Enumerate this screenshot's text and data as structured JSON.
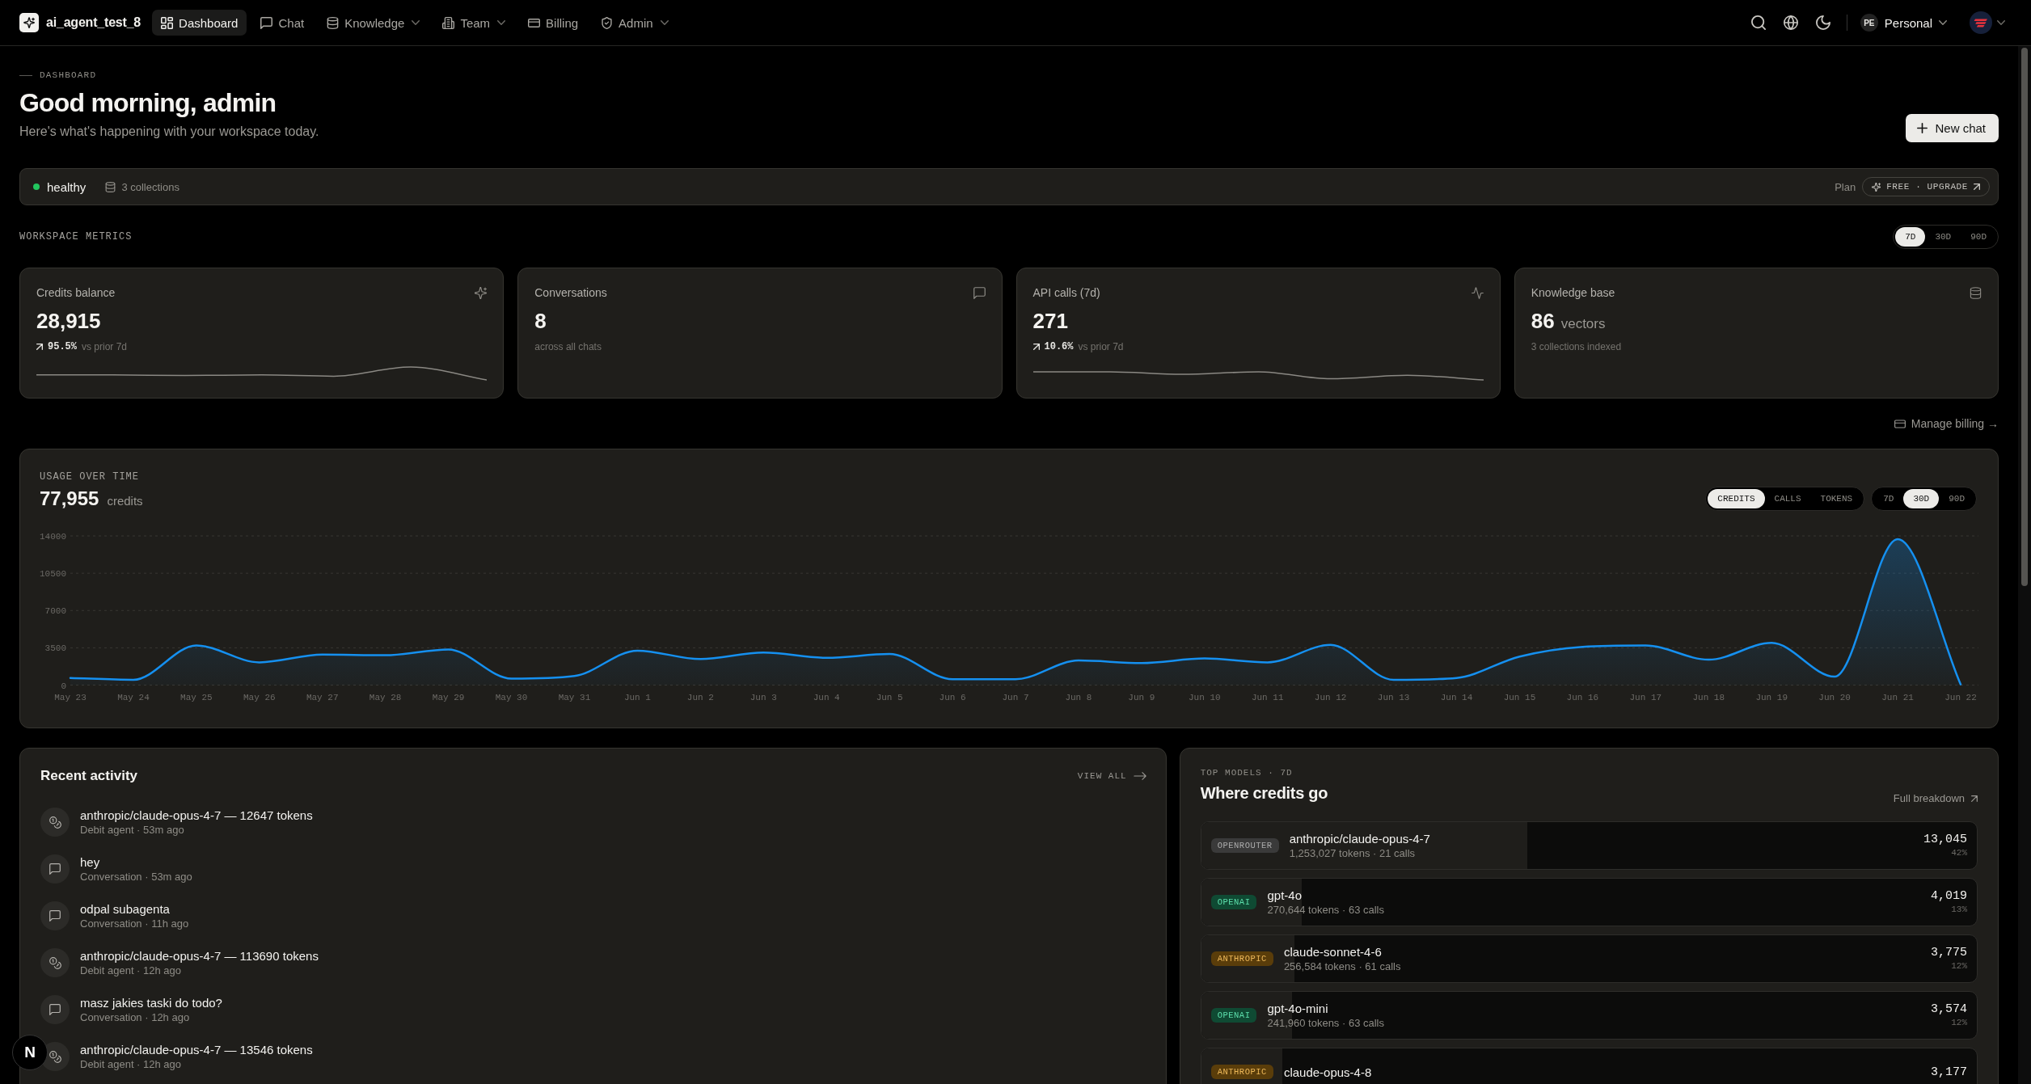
{
  "nav": {
    "brand": "ai_agent_test_8",
    "items": [
      {
        "label": "Dashboard",
        "selected": true,
        "has_menu": false
      },
      {
        "label": "Chat",
        "selected": false,
        "has_menu": false
      },
      {
        "label": "Knowledge",
        "selected": false,
        "has_menu": true
      },
      {
        "label": "Team",
        "selected": false,
        "has_menu": true
      },
      {
        "label": "Billing",
        "selected": false,
        "has_menu": false
      },
      {
        "label": "Admin",
        "selected": false,
        "has_menu": true
      }
    ],
    "workspace": {
      "initials": "PE",
      "name": "Personal"
    }
  },
  "header": {
    "eyebrow": "DASHBOARD",
    "title": "Good morning, admin",
    "subtitle": "Here's what's happening with your workspace today.",
    "action": "New chat"
  },
  "status_bar": {
    "status": "healthy",
    "collections": "3 collections",
    "plan_label": "Plan",
    "plan_badge": "FREE · UPGRADE"
  },
  "metrics": {
    "title": "WORKSPACE METRICS",
    "ranges": [
      {
        "label": "7D",
        "selected": true
      },
      {
        "label": "30D",
        "selected": false
      },
      {
        "label": "90D",
        "selected": false
      }
    ],
    "cards": [
      {
        "label": "Credits balance",
        "value": "28,915",
        "trend": {
          "rising": true,
          "value": "95.5%",
          "caption": "vs prior 7d"
        }
      },
      {
        "label": "Conversations",
        "value": "8",
        "caption": "across all chats"
      },
      {
        "label": "API calls (7d)",
        "value": "271",
        "trend": {
          "rising": true,
          "value": "10.6%",
          "caption": "vs prior 7d"
        }
      },
      {
        "label": "Knowledge base",
        "value": "86",
        "unit": "vectors",
        "caption": "3 collections indexed"
      }
    ]
  },
  "billing_link": "Manage billing →",
  "usage": {
    "title": "USAGE OVER TIME",
    "total": "77,955",
    "unit": "credits",
    "metrics": [
      {
        "label": "CREDITS",
        "selected": true
      },
      {
        "label": "CALLS",
        "selected": false
      },
      {
        "label": "TOKENS",
        "selected": false
      }
    ],
    "ranges": [
      {
        "label": "7D",
        "selected": false
      },
      {
        "label": "30D",
        "selected": true
      },
      {
        "label": "90D",
        "selected": false
      }
    ],
    "chart_data": {
      "type": "area",
      "categories": [
        "May 23",
        "May 24",
        "May 25",
        "May 26",
        "May 27",
        "May 28",
        "May 29",
        "May 30",
        "May 31",
        "Jun 1",
        "Jun 2",
        "Jun 3",
        "Jun 4",
        "Jun 5",
        "Jun 6",
        "Jun 7",
        "Jun 8",
        "Jun 9",
        "Jun 10",
        "Jun 11",
        "Jun 12",
        "Jun 13",
        "Jun 14",
        "Jun 15",
        "Jun 16",
        "Jun 17",
        "Jun 18",
        "Jun 19",
        "Jun 20",
        "Jun 21",
        "Jun 22"
      ],
      "series": [
        {
          "color": "#1590f0",
          "values": [
            670,
            490,
            3720,
            2130,
            2860,
            2800,
            3350,
            610,
            850,
            3230,
            2440,
            3050,
            2560,
            2920,
            550,
            550,
            2310,
            2070,
            2500,
            2130,
            3780,
            490,
            670,
            2680,
            3590,
            3720,
            2380,
            3960,
            790,
            13700,
            60
          ]
        }
      ],
      "ylim": [
        0,
        14000
      ],
      "yticks": [
        0,
        3500,
        7000,
        10500,
        14000
      ],
      "grid": true
    }
  },
  "recent_activity": {
    "title": "Recent activity",
    "link": "VIEW ALL",
    "items": [
      {
        "kind": "debit",
        "title": "anthropic/claude-opus-4-7 — 12647 tokens",
        "meta": "Debit agent · 53m ago"
      },
      {
        "kind": "conversation",
        "title": "hey",
        "meta": "Conversation · 53m ago"
      },
      {
        "kind": "conversation",
        "title": "odpal subagenta",
        "meta": "Conversation · 11h ago"
      },
      {
        "kind": "debit",
        "title": "anthropic/claude-opus-4-7 — 113690 tokens",
        "meta": "Debit agent · 12h ago"
      },
      {
        "kind": "conversation",
        "title": "masz jakies taski do todo?",
        "meta": "Conversation · 12h ago"
      },
      {
        "kind": "debit",
        "title": "anthropic/claude-opus-4-7 — 13546 tokens",
        "meta": "Debit agent · 12h ago"
      }
    ]
  },
  "top_models": {
    "eyebrow": "TOP MODELS · 7D",
    "title": "Where credits go",
    "link": "Full breakdown",
    "rows": [
      {
        "provider": "OPENROUTER",
        "color": "#3a3a3a",
        "name": "anthropic/claude-opus-4-7",
        "detail": "1,253,027 tokens · 21 calls",
        "credits": "13,045",
        "share": "42%",
        "level": 0.42
      },
      {
        "provider": "OPENAI",
        "color": "#0f4a33",
        "name": "gpt-4o",
        "detail": "270,644 tokens · 63 calls",
        "credits": "4,019",
        "share": "13%",
        "level": 0.13
      },
      {
        "provider": "ANTHROPIC",
        "color": "#5a3d0a",
        "name": "claude-sonnet-4-6",
        "detail": "256,584 tokens · 61 calls",
        "credits": "3,775",
        "share": "12%",
        "level": 0.12
      },
      {
        "provider": "OPENAI",
        "color": "#0f4a33",
        "name": "gpt-4o-mini",
        "detail": "241,960 tokens · 63 calls",
        "credits": "3,574",
        "share": "12%",
        "level": 0.117
      },
      {
        "provider": "ANTHROPIC",
        "color": "#5a3d0a",
        "name": "claude-opus-4-8",
        "credits": "3,177",
        "level": 0.105
      }
    ]
  },
  "dev_indicator": "N"
}
